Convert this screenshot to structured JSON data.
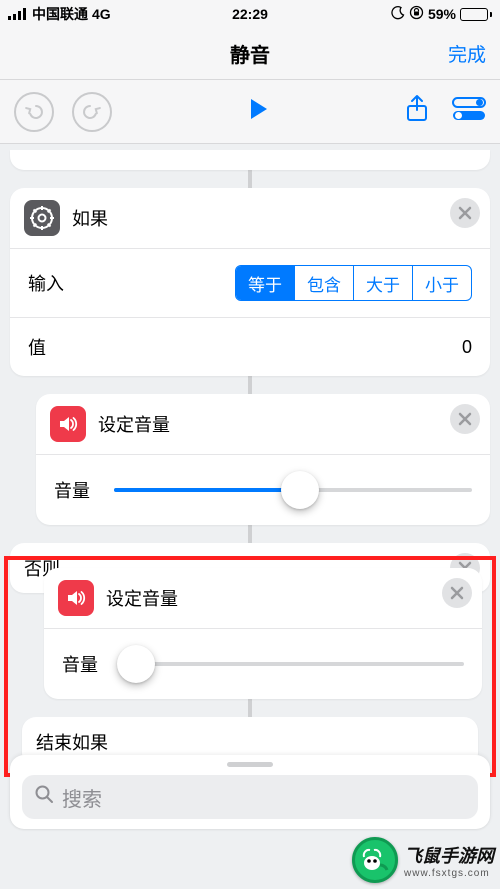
{
  "status": {
    "carrier": "中国联通",
    "network": "4G",
    "time": "22:29",
    "battery_pct": "59%"
  },
  "titlebar": {
    "title": "静音",
    "done": "完成"
  },
  "if_card": {
    "title": "如果",
    "input_label": "输入",
    "seg": {
      "opt1": "等于",
      "opt2": "包含",
      "opt3": "大于",
      "opt4": "小于"
    },
    "value_label": "值",
    "value": "0"
  },
  "set_volume1": {
    "title": "设定音量",
    "label": "音量",
    "value_pct": 52
  },
  "else_card": {
    "title": "否则"
  },
  "set_volume2": {
    "title": "设定音量",
    "label": "音量",
    "value_pct": 4
  },
  "endif": {
    "title": "结束如果"
  },
  "search": {
    "placeholder": "搜索"
  },
  "watermark": {
    "brand": "飞鼠手游网",
    "url": "www.fsxtgs.com"
  }
}
